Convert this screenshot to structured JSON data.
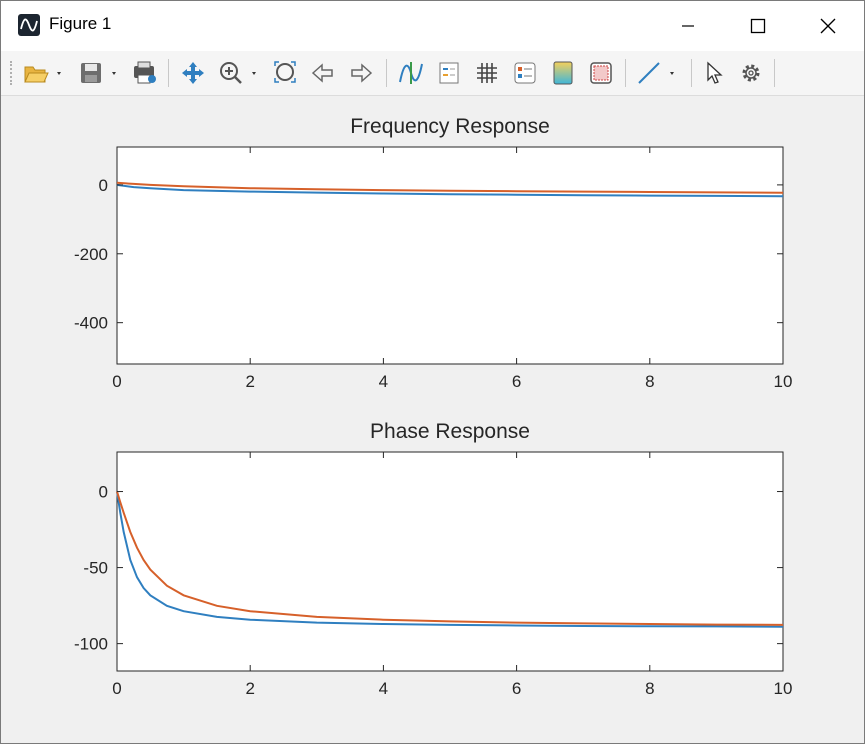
{
  "window": {
    "title": "Figure 1",
    "controls": [
      "minimize",
      "maximize",
      "close"
    ]
  },
  "toolbar": {
    "items": [
      "open-file",
      "save",
      "export",
      "pan",
      "zoom-in",
      "zoom-fit",
      "back",
      "forward",
      "data-cursor",
      "insert-legend",
      "grid",
      "insert-colorbar",
      "colormap",
      "property-editor",
      "line",
      "select",
      "settings"
    ]
  },
  "colors": {
    "series1": "#2f7fc0",
    "series2": "#d6602a",
    "axis": "#262626",
    "background": "#f0f0f0"
  },
  "chart_data": [
    {
      "type": "line",
      "title": "Frequency Response",
      "xlabel": "",
      "ylabel": "",
      "xlim": [
        0,
        10
      ],
      "ylim": [
        -520,
        110
      ],
      "xticks": [
        0,
        2,
        4,
        6,
        8,
        10
      ],
      "yticks": [
        0,
        -200,
        -400
      ],
      "grid": false,
      "series": [
        {
          "x": [
            0,
            0.25,
            0.5,
            1,
            1.5,
            2,
            3,
            4,
            5,
            6,
            7,
            8,
            9,
            10
          ],
          "values": [
            0,
            -6.5,
            -10,
            -15,
            -17.5,
            -19.5,
            -22.5,
            -25,
            -27,
            -28.5,
            -29.8,
            -31,
            -32,
            -33
          ]
        },
        {
          "x": [
            0,
            0.25,
            0.5,
            1,
            1.5,
            2,
            3,
            4,
            5,
            6,
            7,
            8,
            9,
            10
          ],
          "values": [
            6,
            3,
            0,
            -4,
            -7,
            -9.5,
            -12.5,
            -15,
            -16.8,
            -18.3,
            -19.6,
            -20.7,
            -21.7,
            -22.6
          ]
        }
      ]
    },
    {
      "type": "line",
      "title": "Phase Response",
      "xlabel": "",
      "ylabel": "",
      "xlim": [
        0,
        10
      ],
      "ylim": [
        -118,
        26
      ],
      "xticks": [
        0,
        2,
        4,
        6,
        8,
        10
      ],
      "yticks": [
        0,
        -50,
        -100
      ],
      "grid": false,
      "series": [
        {
          "x": [
            0,
            0.05,
            0.1,
            0.2,
            0.3,
            0.4,
            0.5,
            0.75,
            1,
            1.5,
            2,
            3,
            4,
            5,
            6,
            7,
            8,
            9,
            10
          ],
          "values": [
            0,
            -14,
            -26.6,
            -45,
            -56.3,
            -63.4,
            -68.2,
            -75.1,
            -78.7,
            -82.4,
            -84.3,
            -86.2,
            -87.1,
            -87.7,
            -88.1,
            -88.4,
            -88.6,
            -88.7,
            -88.9
          ]
        },
        {
          "x": [
            0,
            0.05,
            0.1,
            0.2,
            0.3,
            0.4,
            0.5,
            0.75,
            1,
            1.5,
            2,
            3,
            4,
            5,
            6,
            7,
            8,
            9,
            10
          ],
          "values": [
            0,
            -7.1,
            -14,
            -26.6,
            -36.9,
            -45,
            -51.3,
            -61.9,
            -68.2,
            -75.1,
            -78.7,
            -82.4,
            -84.3,
            -85.4,
            -86.2,
            -86.7,
            -87.1,
            -87.5,
            -87.7
          ]
        }
      ]
    }
  ]
}
